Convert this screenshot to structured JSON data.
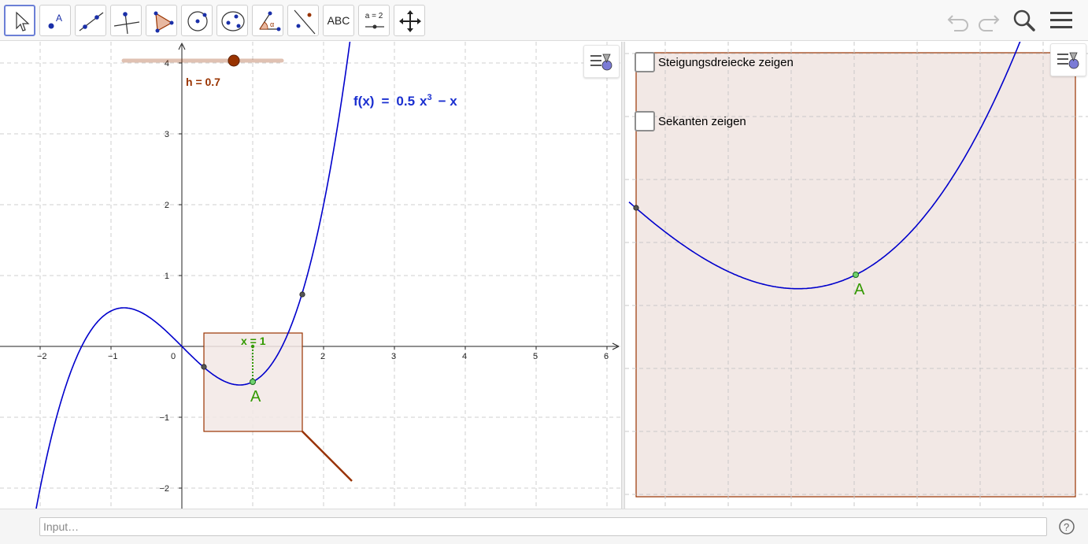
{
  "toolbar": {
    "tools": [
      {
        "name": "move-tool",
        "label": ""
      },
      {
        "name": "point-tool",
        "label": "A"
      },
      {
        "name": "line-tool",
        "label": ""
      },
      {
        "name": "perpendicular-tool",
        "label": ""
      },
      {
        "name": "polygon-tool",
        "label": ""
      },
      {
        "name": "circle-tool",
        "label": ""
      },
      {
        "name": "ellipse-tool",
        "label": ""
      },
      {
        "name": "angle-tool",
        "label": "α"
      },
      {
        "name": "reflect-tool",
        "label": ""
      },
      {
        "name": "text-tool",
        "label": "ABC"
      },
      {
        "name": "slider-tool",
        "label": "a = 2"
      },
      {
        "name": "move-view-tool",
        "label": ""
      }
    ],
    "icons": [
      "undo-icon",
      "redo-icon",
      "search-icon",
      "menu-icon"
    ]
  },
  "graphics1": {
    "x_ticks": [
      "−2",
      "−1",
      "0",
      "1",
      "2",
      "3",
      "4",
      "5",
      "6"
    ],
    "y_ticks": [
      "4",
      "3",
      "2",
      "1",
      "−1",
      "−2"
    ],
    "slider_label": "h = 0.7",
    "slider_value": 0.7,
    "function_label": "f(x) = 0.5 x³ − x",
    "function_parts": {
      "name": "f(x)",
      "eq": "=",
      "coef": "0.5",
      "var": "x",
      "exp": "3",
      "rest": "− x"
    },
    "x_label": "x = 1",
    "point_label": "A"
  },
  "graphics2": {
    "checkbox_slope_triangles": "Steigungsdreiecke zeigen",
    "checkbox_secants": "Sekanten zeigen",
    "point_label": "A"
  },
  "input": {
    "placeholder": "Input…"
  },
  "colors": {
    "curve": "#0000cc",
    "slider": "#993300",
    "rect_fill": "#f2e8e5",
    "rect_stroke": "#993300",
    "point_green": "#008000",
    "label_green": "#339900"
  }
}
